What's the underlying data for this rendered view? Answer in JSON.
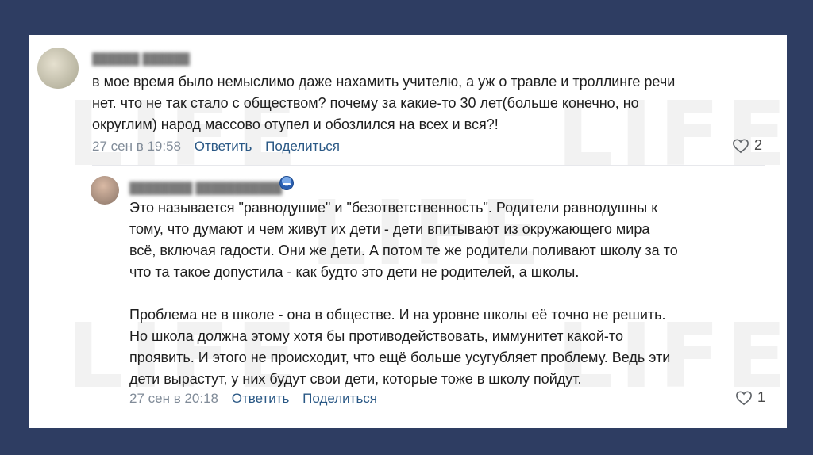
{
  "comments": [
    {
      "text": "в мое время было немыслимо даже нахамить учителю, а уж о травле и троллинге речи\nнет. что не так стало с обществом? почему за какие-то 30 лет(больше конечно, но\nокруглим) народ массово отупел и обозлился на всех и вся?!",
      "date": "27 сен в 19:58",
      "reply_label": "Ответить",
      "share_label": "Поделиться",
      "likes": "2"
    },
    {
      "text": "Это называется \"равнодушие\" и \"безответственность\". Родители равнодушны к\nтому, что думают и чем живут их дети - дети впитывают из окружающего мира\nвсё, включая гадости. Они же дети. А потом те же родители поливают школу за то\nчто та такое допустила - как будто это дети не родителей, а школы.\n\nПроблема не в школе - она в обществе. И на уровне школы её точно не решить.\nНо школа должна этому хотя бы противодействовать, иммунитет какой-то\nпроявить. И этого не происходит, что ещё больше усугубляет проблему. Ведь эти\nдети вырастут, у них будут свои дети, которые тоже в школу пойдут.",
      "date": "27 сен в 20:18",
      "reply_label": "Ответить",
      "share_label": "Поделиться",
      "likes": "1"
    }
  ],
  "watermark": "LIFE",
  "colors": {
    "background": "#2e3d62",
    "link": "#2a5885",
    "meta": "#818c99"
  }
}
